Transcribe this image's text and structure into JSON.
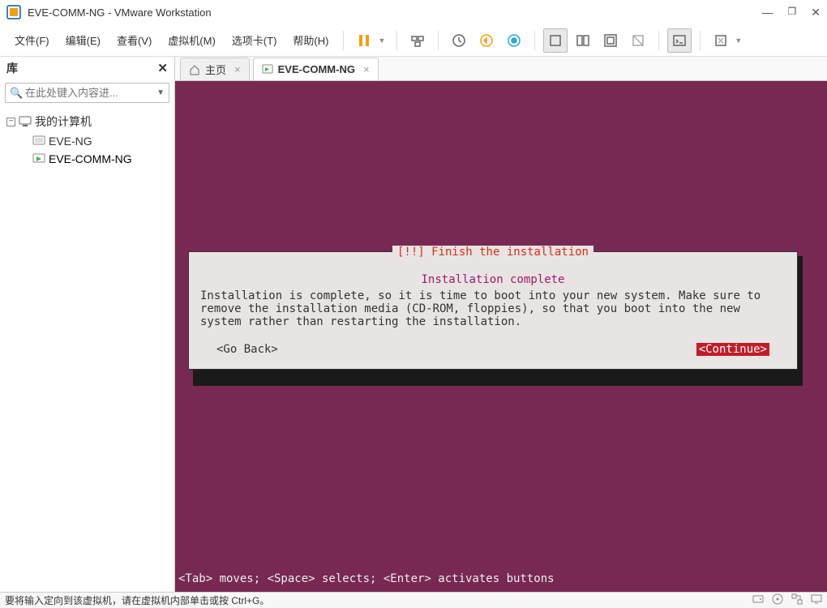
{
  "titlebar": {
    "title": "EVE-COMM-NG - VMware Workstation"
  },
  "menu": {
    "file": "文件(F)",
    "edit": "编辑(E)",
    "view": "查看(V)",
    "vm": "虚拟机(M)",
    "tabs": "选项卡(T)",
    "help": "帮助(H)"
  },
  "sidebar": {
    "title": "库",
    "search_placeholder": "在此处键入内容进...",
    "root_label": "我的计算机",
    "items": [
      {
        "label": "EVE-NG"
      },
      {
        "label": "EVE-COMM-NG"
      }
    ]
  },
  "tabs": {
    "home": "主页",
    "vm": "EVE-COMM-NG"
  },
  "vm": {
    "dialog_title": "[!!] Finish the installation",
    "subtitle": "Installation complete",
    "body": "Installation is complete, so it is time to boot into your new system. Make sure to remove the installation media (CD-ROM, floppies), so that you boot into the new system rather than restarting the installation.",
    "go_back": "<Go Back>",
    "continue": "<Continue>",
    "hint": "<Tab> moves; <Space> selects; <Enter> activates buttons"
  },
  "status": {
    "message": "要将输入定向到该虚拟机，请在虚拟机内部单击或按 Ctrl+G。"
  }
}
